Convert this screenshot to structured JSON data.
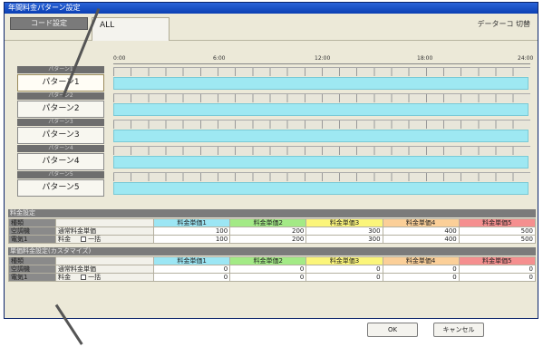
{
  "window": {
    "title": "年間料金パターン設定"
  },
  "tabs": [
    {
      "label": "コード設定"
    },
    {
      "label": "ALL"
    }
  ],
  "data_switch": "データーコ 切替",
  "timeline": {
    "ticks": [
      "0:00",
      "6:00",
      "12:00",
      "18:00",
      "24:00"
    ]
  },
  "patterns": [
    {
      "name": "パターン1",
      "label": "パターン1"
    },
    {
      "name": "パターン2",
      "label": "パターン2"
    },
    {
      "name": "パターン3",
      "label": "パターン3"
    },
    {
      "name": "パターン4",
      "label": "パターン4"
    },
    {
      "name": "パターン5",
      "label": "パターン5"
    }
  ],
  "fee_setting": {
    "section": "料金設定",
    "header_label": "種類",
    "columns": [
      "料金単価1",
      "料金単価2",
      "料金単価3",
      "料金単価4",
      "料金単価5"
    ],
    "rows": [
      {
        "label": "空調機",
        "sub": "通常料金単価",
        "values": [
          "100",
          "200",
          "300",
          "400",
          "500"
        ]
      },
      {
        "label": "電気1",
        "sub": "料金",
        "check": "一括",
        "values": [
          "100",
          "200",
          "300",
          "400",
          "500"
        ]
      }
    ]
  },
  "fee_calc": {
    "section": "単価料金設定(カスタマイズ)",
    "header_label": "種類",
    "columns": [
      "料金単価1",
      "料金単価2",
      "料金単価3",
      "料金単価4",
      "料金単価5"
    ],
    "rows": [
      {
        "label": "空調機",
        "sub": "通常料金単価",
        "values": [
          "0",
          "0",
          "0",
          "0",
          "0"
        ]
      },
      {
        "label": "電気1",
        "sub": "料金",
        "check": "一括",
        "values": [
          "0",
          "0",
          "0",
          "0",
          "0"
        ]
      }
    ]
  },
  "buttons": {
    "ok": "OK",
    "cancel": "キャンセル"
  },
  "colors": {
    "bar": "#9ee8f2",
    "c1": "#9ce6f4",
    "c2": "#a3ea86",
    "c3": "#fbf57a",
    "c4": "#fbcf98",
    "c5": "#f58f8f"
  }
}
